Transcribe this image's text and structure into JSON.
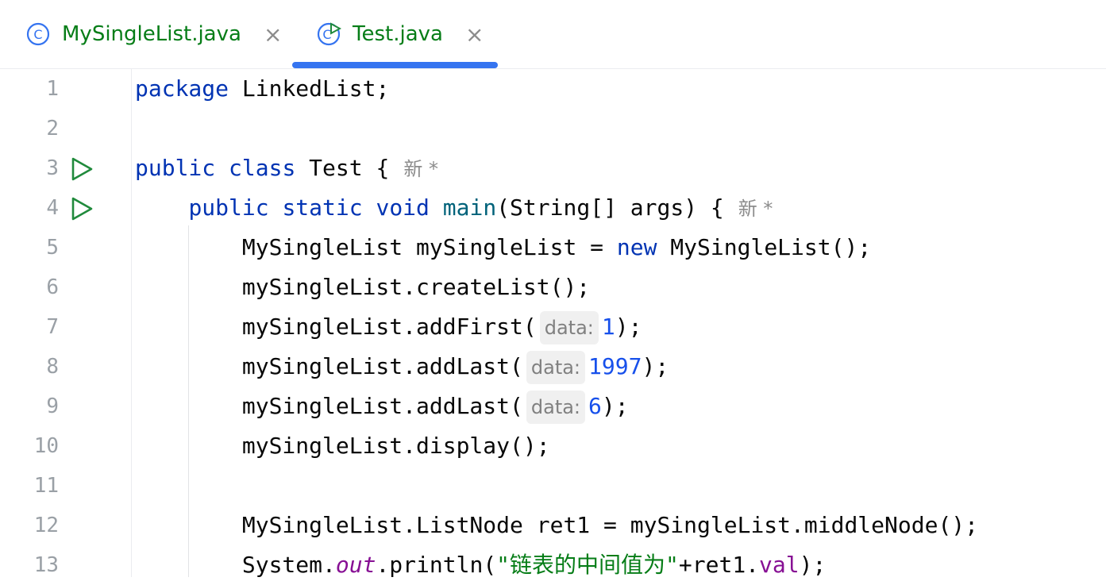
{
  "tabs": [
    {
      "label": "MySingleList.java",
      "close": "×",
      "icon": "class-icon",
      "active": false
    },
    {
      "label": "Test.java",
      "close": "×",
      "icon": "runnable-class-icon",
      "active": true
    }
  ],
  "colors": {
    "keyword": "#0033b3",
    "method": "#00627a",
    "number": "#1750eb",
    "string": "#067d17",
    "field": "#871094",
    "accent": "#3574f0",
    "run": "#208a3c"
  },
  "lines": {
    "l1": {
      "n": "1",
      "kw": "package",
      "rest": " LinkedList;"
    },
    "l2": {
      "n": "2"
    },
    "l3": {
      "n": "3",
      "kw1": "public",
      "kw2": "class",
      "rest": " Test {",
      "author": "新 *"
    },
    "l4": {
      "n": "4",
      "indent": "    ",
      "kw1": "public",
      "kw2": "static",
      "kw3": "void",
      "fn": "main",
      "rest": "(String[] args) {",
      "author": "新 *"
    },
    "l5": {
      "n": "5",
      "a": "        MySingleList mySingleList = ",
      "kw": "new",
      "b": " MySingleList();"
    },
    "l6": {
      "n": "6",
      "a": "        mySingleList.createList();"
    },
    "l7": {
      "n": "7",
      "a": "        mySingleList.addFirst(",
      "hint": "data:",
      "num": "1",
      "b": ");"
    },
    "l8": {
      "n": "8",
      "a": "        mySingleList.addLast(",
      "hint": "data:",
      "num": "1997",
      "b": ");"
    },
    "l9": {
      "n": "9",
      "a": "        mySingleList.addLast(",
      "hint": "data:",
      "num": "6",
      "b": ");"
    },
    "l10": {
      "n": "10",
      "a": "        mySingleList.display();"
    },
    "l11": {
      "n": "11"
    },
    "l12": {
      "n": "12",
      "a": "        MySingleList.ListNode ret1 = mySingleList.middleNode();"
    },
    "l13": {
      "n": "13",
      "a": "        System.",
      "sf": "out",
      "b": ".println(",
      "str": "\"链表的中间值为\"",
      "c": "+ret1.",
      "field": "val",
      "d": ");"
    }
  }
}
